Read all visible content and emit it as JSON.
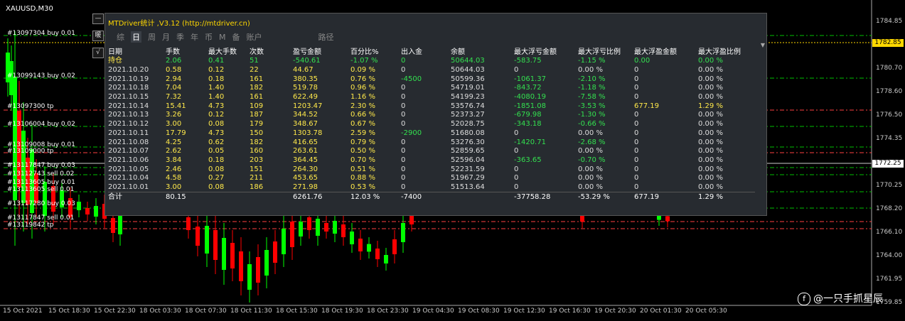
{
  "symbol": "XAUUSD,M30",
  "colors": {
    "bull": "#00ff00",
    "bear": "#ff0000",
    "grid": "#2a2a2a",
    "order_buy": "#00c000",
    "order_sell": "#ff4040",
    "accent": "#ffd800",
    "green_text": "#33e04f",
    "yellow_text": "#ffe94a"
  },
  "price_axis": {
    "labels": [
      "1784.85",
      "1782.85",
      "1780.70",
      "1778.60",
      "1776.50",
      "1774.35",
      "1772.25",
      "1770.25",
      "1768.20",
      "1766.10",
      "1764.00",
      "1761.95",
      "1759.85"
    ],
    "current_bid": "1782.85",
    "current_line": "1772.25"
  },
  "time_axis": [
    "15 Oct 2021",
    "15 Oct 18:30",
    "15 Oct 22:30",
    "18 Oct 03:30",
    "18 Oct 07:30",
    "18 Oct 11:30",
    "18 Oct 15:30",
    "18 Oct 19:30",
    "18 Oct 23:30",
    "19 Oct 04:30",
    "19 Oct 08:30",
    "19 Oct 12:30",
    "19 Oct 16:30",
    "19 Oct 20:30",
    "20 Oct 01:30",
    "20 Oct 05:30"
  ],
  "order_labels": [
    {
      "text": "#13097304 buy 0.01"
    },
    {
      "text": "#13099143 buy 0.02"
    },
    {
      "text": "#13097300 tp"
    },
    {
      "text": "#13106004 buy 0.02"
    },
    {
      "text": "#13109008 buy 0.01"
    },
    {
      "text": "#13109000 tp"
    },
    {
      "text": "#13117847 buy 0.03"
    },
    {
      "text": "#13112743 sell 0.02"
    },
    {
      "text": "#13113605 buy 0.01"
    },
    {
      "text": "#13113605 sell 0.01"
    },
    {
      "text": "#13117280 buy 0.03"
    },
    {
      "text": "#13117847 sell 0.01"
    },
    {
      "text": "#13119842 tp"
    }
  ],
  "controls": {
    "minimize": "—",
    "restore": "暖",
    "check": "√"
  },
  "panel": {
    "title": "MTDriver统计 ,V3.12 (http://mtdriver.cn)",
    "tabs": [
      "综",
      "日",
      "周",
      "月",
      "季",
      "年",
      "币",
      "M",
      "备",
      "账户",
      "路径"
    ],
    "active_tab": "日",
    "scroll_indicator": "▼",
    "headers": [
      "日期",
      "手数",
      "最大手数",
      "次数",
      "盈亏金额",
      "百分比%",
      "出入金",
      "余额",
      "最大浮亏金额",
      "最大浮亏比例",
      "最大浮盈金额",
      "最大浮盈比例"
    ],
    "holding": [
      "持仓",
      "2.06",
      "0.41",
      "51",
      "-540.61",
      "-1.07 %",
      "0",
      "50644.03",
      "-583.75",
      "-1.15 %",
      "0.00",
      "0.00 %"
    ],
    "rows": [
      [
        "2021.10.20",
        "0.58",
        "0.12",
        "22",
        "44.67",
        "0.09 %",
        "0",
        "50644.03",
        "0",
        "0.00 %",
        "0",
        "0.00 %"
      ],
      [
        "2021.10.19",
        "2.94",
        "0.18",
        "161",
        "380.35",
        "0.76 %",
        "-4500",
        "50599.36",
        "-1061.37",
        "-2.10 %",
        "0",
        "0.00 %"
      ],
      [
        "2021.10.18",
        "7.04",
        "1.40",
        "182",
        "519.78",
        "0.96 %",
        "0",
        "54719.01",
        "-843.72",
        "-1.18 %",
        "0",
        "0.00 %"
      ],
      [
        "2021.10.15",
        "7.32",
        "1.40",
        "161",
        "622.49",
        "1.16 %",
        "0",
        "54199.23",
        "-4080.19",
        "-7.58 %",
        "0",
        "0.00 %"
      ],
      [
        "2021.10.14",
        "15.41",
        "4.73",
        "109",
        "1203.47",
        "2.30 %",
        "0",
        "53576.74",
        "-1851.08",
        "-3.53 %",
        "677.19",
        "1.29 %"
      ],
      [
        "2021.10.13",
        "3.26",
        "0.12",
        "187",
        "344.52",
        "0.66 %",
        "0",
        "52373.27",
        "-679.98",
        "-1.30 %",
        "0",
        "0.00 %"
      ],
      [
        "2021.10.12",
        "3.00",
        "0.08",
        "179",
        "348.67",
        "0.67 %",
        "0",
        "52028.75",
        "-343.18",
        "-0.66 %",
        "0",
        "0.00 %"
      ],
      [
        "2021.10.11",
        "17.79",
        "4.73",
        "150",
        "1303.78",
        "2.59 %",
        "-2900",
        "51680.08",
        "0",
        "0.00 %",
        "0",
        "0.00 %"
      ],
      [
        "2021.10.08",
        "4.25",
        "0.62",
        "182",
        "416.65",
        "0.79 %",
        "0",
        "53276.30",
        "-1420.71",
        "-2.68 %",
        "0",
        "0.00 %"
      ],
      [
        "2021.10.07",
        "2.62",
        "0.05",
        "160",
        "263.61",
        "0.50 %",
        "0",
        "52859.65",
        "0",
        "0.00 %",
        "0",
        "0.00 %"
      ],
      [
        "2021.10.06",
        "3.84",
        "0.18",
        "203",
        "364.45",
        "0.70 %",
        "0",
        "52596.04",
        "-363.65",
        "-0.70 %",
        "0",
        "0.00 %"
      ],
      [
        "2021.10.05",
        "2.46",
        "0.08",
        "151",
        "264.30",
        "0.51 %",
        "0",
        "52231.59",
        "0",
        "0.00 %",
        "0",
        "0.00 %"
      ],
      [
        "2021.10.04",
        "4.58",
        "0.27",
        "211",
        "453.65",
        "0.88 %",
        "0",
        "51967.29",
        "0",
        "0.00 %",
        "0",
        "0.00 %"
      ],
      [
        "2021.10.01",
        "3.00",
        "0.08",
        "186",
        "271.98",
        "0.53 %",
        "0",
        "51513.64",
        "0",
        "0.00 %",
        "0",
        "0.00 %"
      ]
    ],
    "total": [
      "合计",
      "80.15",
      "",
      "",
      "6261.76",
      "12.03 %",
      "-7400",
      "",
      "-37758.28",
      "-53.29 %",
      "677.19",
      "1.29 %"
    ]
  },
  "watermark": {
    "icon": "f",
    "text": "@一只手抓星辰"
  }
}
